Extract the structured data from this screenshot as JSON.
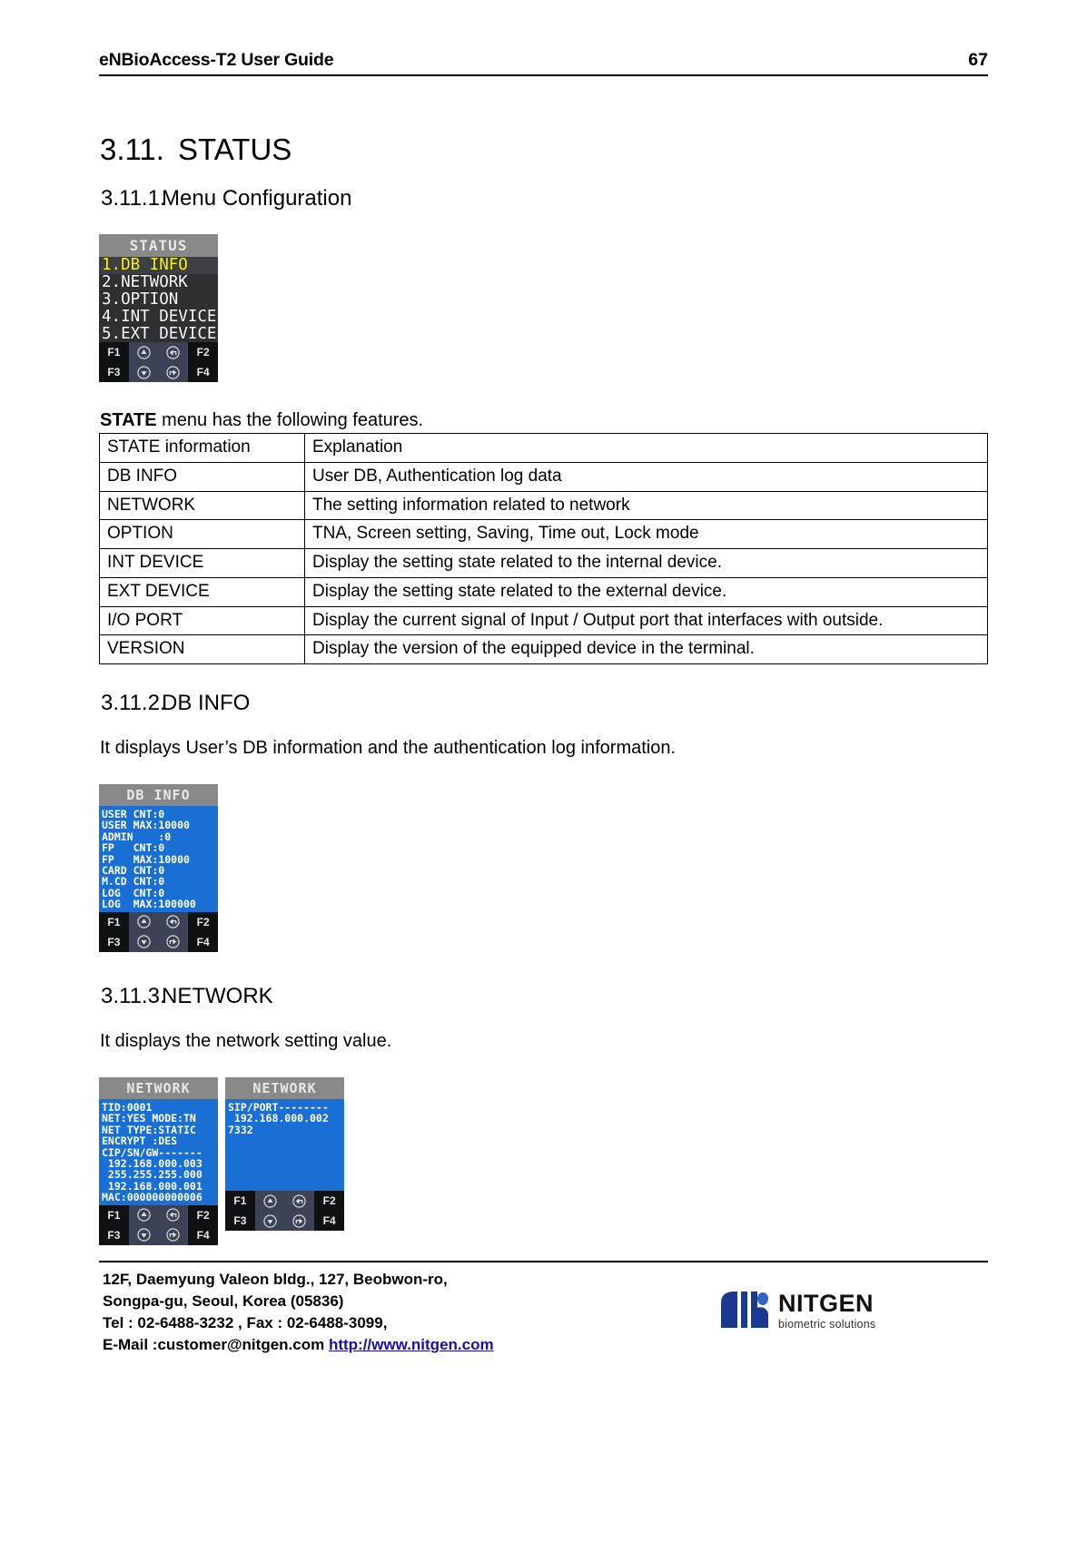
{
  "header": {
    "title": "eNBioAccess-T2 User Guide",
    "page_number": "67"
  },
  "headings": {
    "h1_num": "3.11.",
    "h1_text": "STATUS",
    "h2_1_num": "3.11.1.",
    "h2_1_text": "Menu Configuration",
    "h2_2_num": "3.11.2.",
    "h2_2_text": "DB INFO",
    "h2_3_num": "3.11.3.",
    "h2_3_text": "NETWORK"
  },
  "paragraphs": {
    "lead_bold": "STATE",
    "lead_rest": " menu has the following features.",
    "db_info": "It displays User’s DB information and the authentication log information.",
    "network": "It displays the network setting value."
  },
  "status_screen": {
    "title": "STATUS",
    "items": [
      "1.DB INFO",
      "2.NETWORK",
      "3.OPTION",
      "4.INT DEVICE",
      "5.EXT DEVICE"
    ],
    "selected_index": 0
  },
  "dbinfo_screen": {
    "title": "DB INFO",
    "lines": [
      "USER CNT:0",
      "USER MAX:10000",
      "ADMIN    :0",
      "FP   CNT:0",
      "FP   MAX:10000",
      "CARD CNT:0",
      "M.CD CNT:0",
      "LOG  CNT:0",
      "LOG  MAX:100000"
    ]
  },
  "network_screen_1": {
    "title": "NETWORK",
    "lines": [
      "TID:0001",
      "NET:YES MODE:TN",
      "NET TYPE:STATIC",
      "ENCRYPT :DES",
      "CIP/SN/GW-------",
      " 192.168.000.003",
      " 255.255.255.000",
      " 192.168.000.001",
      "MAC:000000000006"
    ]
  },
  "network_screen_2": {
    "title": "NETWORK",
    "lines": [
      "SIP/PORT--------",
      " 192.168.000.002",
      "7332"
    ]
  },
  "keypad": {
    "f1": "F1",
    "f2": "F2",
    "f3": "F3",
    "f4": "F4",
    "up_icon": "up-arrow-icon",
    "back_icon": "back-arrow-icon",
    "down_icon": "down-arrow-icon",
    "enter_icon": "enter-arrow-icon"
  },
  "table": {
    "headers": [
      "STATE information",
      "Explanation"
    ],
    "rows": [
      [
        "DB INFO",
        "User DB, Authentication log data"
      ],
      [
        "NETWORK",
        "The setting information related to network"
      ],
      [
        "OPTION",
        "TNA, Screen setting, Saving, Time out, Lock mode"
      ],
      [
        "INT DEVICE",
        "Display the setting state related to the internal device."
      ],
      [
        "EXT DEVICE",
        "Display the setting state related to the external device."
      ],
      [
        "I/O PORT",
        "Display the current signal of Input / Output port that interfaces with outside."
      ],
      [
        "VERSION",
        "Display the version of the equipped device in the terminal."
      ]
    ],
    "io_port_line1": "Display  the  current  signal  of  Input  /  Output  port  that  interfaces  with",
    "io_port_line2": "outside."
  },
  "footer": {
    "line1": "12F, Daemyung Valeon bldg., 127, Beobwon-ro,",
    "line2": "Songpa-gu, Seoul, Korea (05836)",
    "line3": "Tel : 02-6488-3232 , Fax : 02-6488-3099,",
    "line4_label": "E-Mail :customer@nitgen.com ",
    "line4_link": "http://www.nitgen.com",
    "logo_name": "NITGEN",
    "logo_sub": "biometric solutions"
  },
  "colors": {
    "lcd_blue": "#1a6fd4",
    "lcd_title_gray": "#898989",
    "menu_dark": "#2f3032",
    "selected_yellow": "#ffff00",
    "link_blue": "#1a0dab"
  }
}
